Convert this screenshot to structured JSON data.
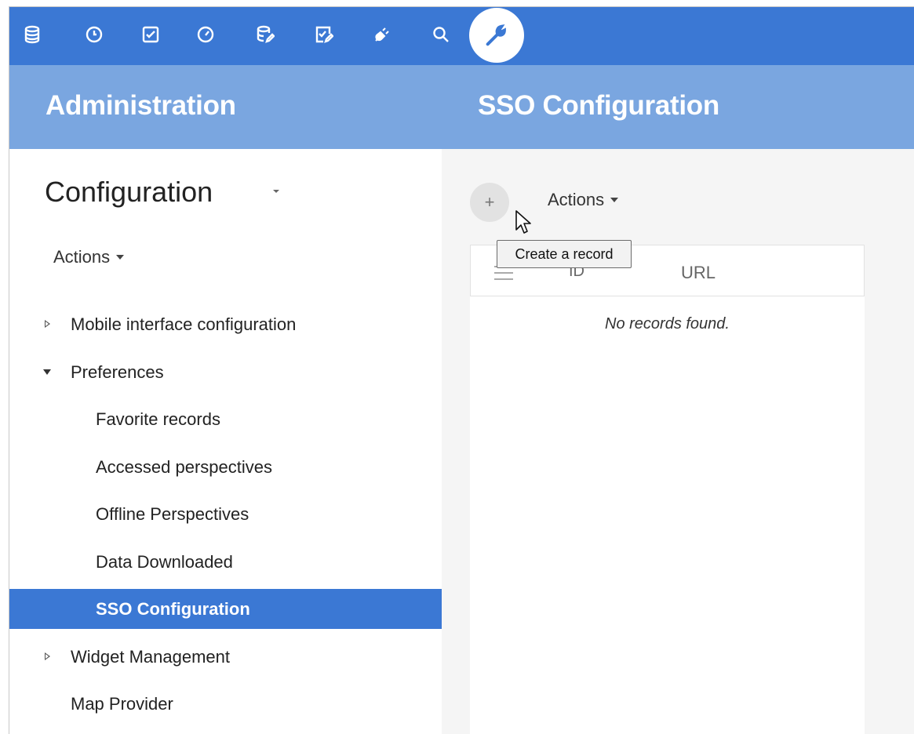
{
  "toolbar": {
    "icons": [
      "database-icon",
      "clock-icon",
      "checkbox-icon",
      "gauge-icon",
      "database-edit-icon",
      "checkbox-edit-icon",
      "plug-icon",
      "search-icon"
    ],
    "active_icon": "wrench-icon",
    "color": "#3b78d4"
  },
  "header": {
    "left_title": "Administration",
    "right_title": "SSO Configuration",
    "color": "#7aa6e0"
  },
  "sidebar": {
    "heading": "Configuration",
    "actions_label": "Actions",
    "items": [
      {
        "label": "Mobile interface configuration",
        "level": 0,
        "toggle": "collapsed"
      },
      {
        "label": "Preferences",
        "level": 0,
        "toggle": "expanded"
      },
      {
        "label": "Favorite records",
        "level": 1
      },
      {
        "label": "Accessed perspectives",
        "level": 1
      },
      {
        "label": "Offline Perspectives",
        "level": 1
      },
      {
        "label": "Data Downloaded",
        "level": 1
      },
      {
        "label": "SSO Configuration",
        "level": 1,
        "selected": true
      },
      {
        "label": "Widget Management",
        "level": 0,
        "toggle": "collapsed"
      },
      {
        "label": "Map Provider",
        "level": 0
      }
    ],
    "selected_color": "#3b78d4"
  },
  "content": {
    "add_button_label": "+",
    "actions_label": "Actions",
    "tooltip": "Create a record",
    "columns": {
      "id": "ID",
      "url": "URL"
    },
    "sort_glyph": "^",
    "empty_message": "No records found."
  }
}
